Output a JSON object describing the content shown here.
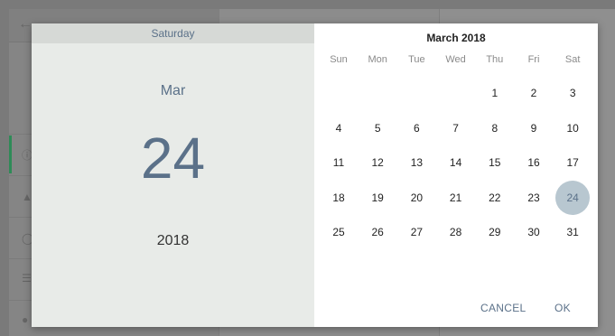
{
  "dialog": {
    "weekday": "Saturday",
    "month_short": "Mar",
    "day": "24",
    "year": "2018",
    "calendar": {
      "title": "March 2018",
      "weekdays": [
        "Sun",
        "Mon",
        "Tue",
        "Wed",
        "Thu",
        "Fri",
        "Sat"
      ],
      "weeks": [
        [
          "",
          "",
          "",
          "",
          "1",
          "2",
          "3"
        ],
        [
          "4",
          "5",
          "6",
          "7",
          "8",
          "9",
          "10"
        ],
        [
          "11",
          "12",
          "13",
          "14",
          "15",
          "16",
          "17"
        ],
        [
          "18",
          "19",
          "20",
          "21",
          "22",
          "23",
          "24"
        ],
        [
          "25",
          "26",
          "27",
          "28",
          "29",
          "30",
          "31"
        ]
      ],
      "selected": "24"
    },
    "cancel_label": "CANCEL",
    "ok_label": "OK"
  },
  "colors": {
    "accent": "#5b7189",
    "selected_circle": "#b8c7d0",
    "header_bg": "#e8ebe8"
  }
}
